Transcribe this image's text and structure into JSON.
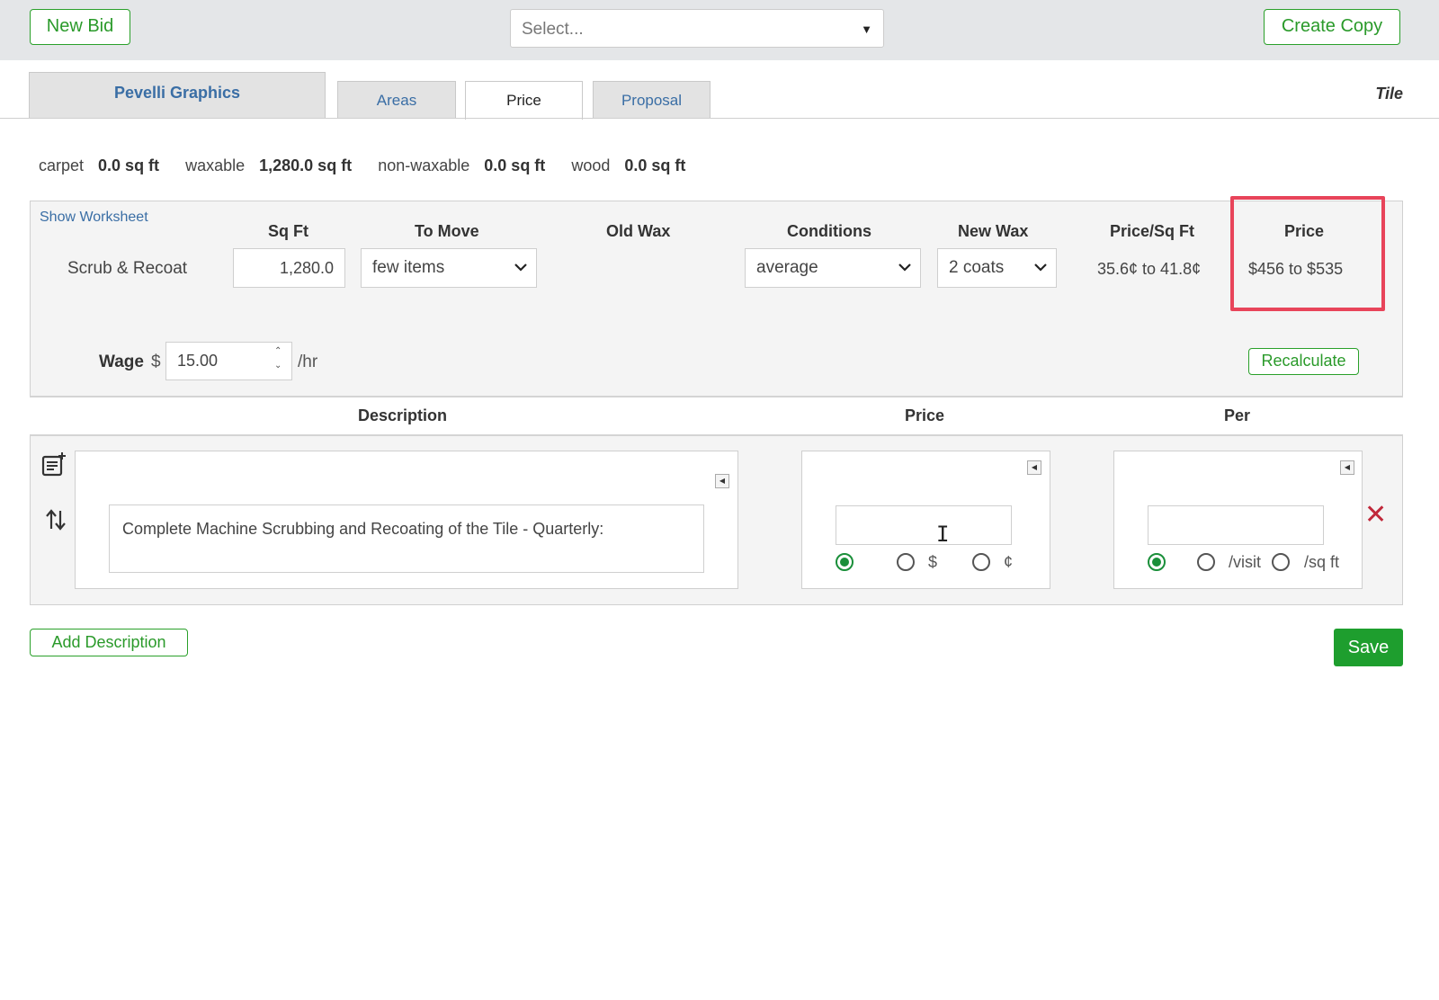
{
  "topbar": {
    "new_bid_label": "New Bid",
    "select_placeholder": "Select...",
    "create_copy_label": "Create Copy"
  },
  "tabs": {
    "company": "Pevelli Graphics",
    "areas": "Areas",
    "price": "Price",
    "proposal": "Proposal",
    "active": "Price"
  },
  "floor_type": "Tile",
  "summary": [
    {
      "label": "carpet",
      "value": "0.0 sq ft"
    },
    {
      "label": "waxable",
      "value": "1,280.0 sq ft"
    },
    {
      "label": "non-waxable",
      "value": "0.0 sq ft"
    },
    {
      "label": "wood",
      "value": "0.0 sq ft"
    }
  ],
  "worksheet": {
    "show_link": "Show Worksheet",
    "headers": {
      "sqft": "Sq Ft",
      "to_move": "To Move",
      "old_wax": "Old Wax",
      "conditions": "Conditions",
      "new_wax": "New Wax",
      "price_per_sqft": "Price/Sq Ft",
      "price": "Price"
    },
    "row": {
      "label": "Scrub & Recoat",
      "sqft": "1,280.0",
      "to_move": "few items",
      "conditions": "average",
      "new_wax": "2 coats",
      "price_per_sqft": "35.6¢ to 41.8¢",
      "price": "$456 to $535"
    },
    "wage": {
      "label": "Wage",
      "currency": "$",
      "value": "15.00",
      "unit": "/hr"
    },
    "recalculate_label": "Recalculate",
    "highlight_color": "#e8445a"
  },
  "descriptions": {
    "headers": {
      "description": "Description",
      "price": "Price",
      "per": "Per"
    },
    "rows": [
      {
        "text": "Complete Machine Scrubbing and Recoating of the Tile - Quarterly:",
        "price_value": "",
        "price_options": [
          "",
          "$",
          "¢"
        ],
        "price_selected": 0,
        "per_value": "",
        "per_options": [
          "",
          "/visit",
          "/sq ft"
        ],
        "per_selected": 0
      }
    ]
  },
  "buttons": {
    "add_description": "Add Description",
    "save": "Save"
  },
  "colors": {
    "accent_green": "#2aa02a",
    "save_green": "#1e9e2e",
    "link_blue": "#3a6ea5",
    "delete_red": "#c0283a"
  }
}
